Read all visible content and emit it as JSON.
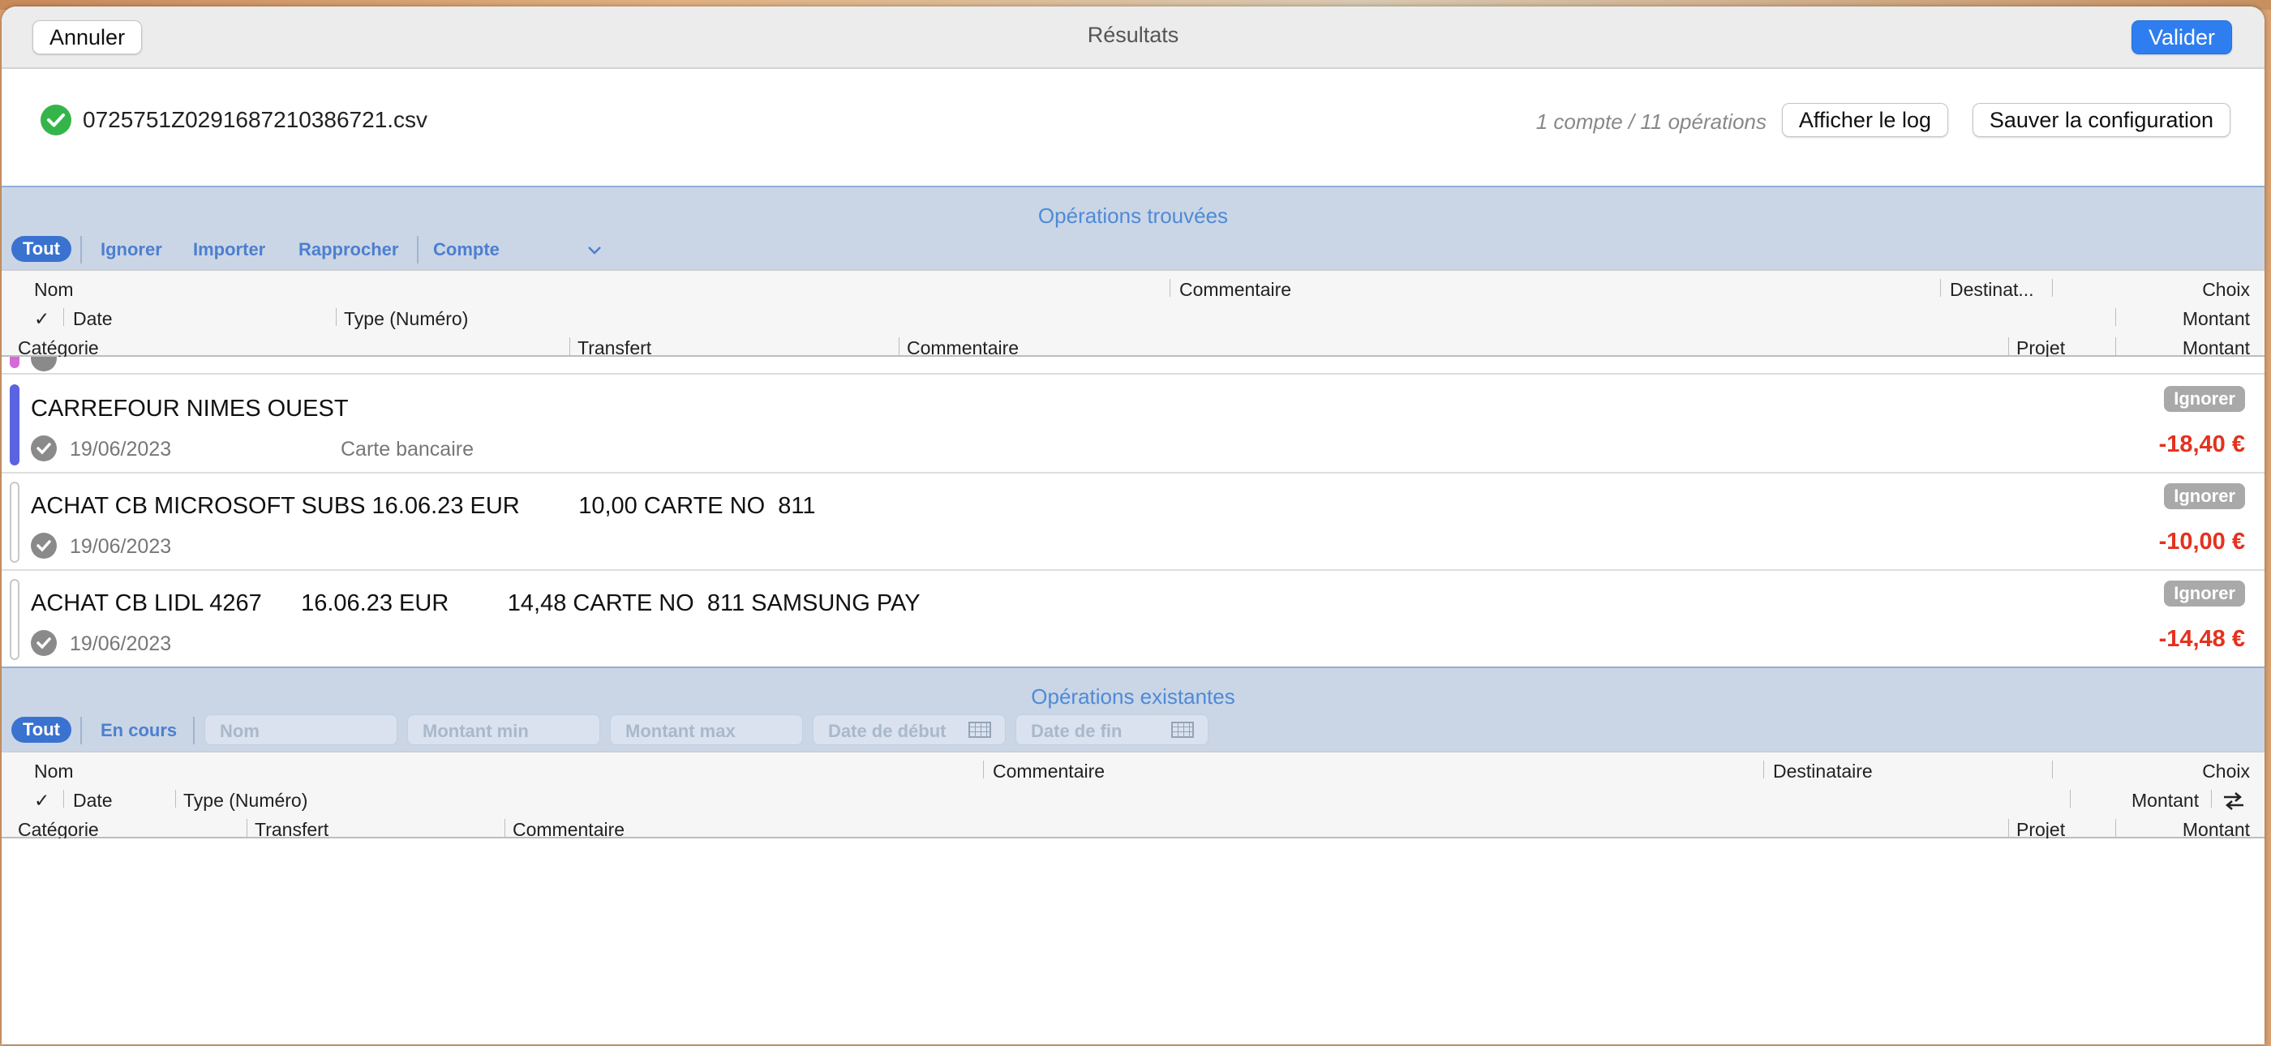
{
  "window": {
    "title": "Résultats",
    "cancel_label": "Annuler",
    "validate_label": "Valider",
    "accent": "#2f7ef0"
  },
  "file": {
    "name": "0725751Z0291687210386721.csv",
    "status_icon": "check-circle-icon",
    "summary": "1 compte / 11 opérations",
    "show_log_label": "Afficher le log",
    "save_config_label": "Sauver la configuration"
  },
  "found": {
    "section_title": "Opérations trouvées",
    "filters": {
      "all": "Tout",
      "ignore": "Ignorer",
      "import": "Importer",
      "reconcile": "Rapprocher",
      "account": "Compte"
    },
    "columns": {
      "name": "Nom",
      "comment": "Commentaire",
      "recipient": "Destinat...",
      "choice": "Choix",
      "check": "✓",
      "date": "Date",
      "type": "Type (Numéro)",
      "amount": "Montant",
      "category": "Catégorie",
      "transfer": "Transfert",
      "comment2": "Commentaire",
      "project": "Projet",
      "amount2": "Montant"
    },
    "rows": [
      {
        "name": "CARREFOUR NIMES OUEST",
        "date": "19/06/2023",
        "type": "Carte bancaire",
        "choice": "Ignorer",
        "amount": "-18,40 €",
        "marker_color": "#5b63e0"
      },
      {
        "name": "ACHAT CB MICROSOFT SUBS 16.06.23 EUR         10,00 CARTE NO  811",
        "date": "19/06/2023",
        "type": "",
        "choice": "Ignorer",
        "amount": "-10,00 €",
        "marker_color": "#ffffff"
      },
      {
        "name": "ACHAT CB LIDL 4267      16.06.23 EUR         14,48 CARTE NO  811 SAMSUNG PAY",
        "date": "19/06/2023",
        "type": "",
        "choice": "Ignorer",
        "amount": "-14,48 €",
        "marker_color": "#ffffff"
      }
    ]
  },
  "existing": {
    "section_title": "Opérations existantes",
    "filters": {
      "all": "Tout",
      "pending": "En cours"
    },
    "search": {
      "name_placeholder": "Nom",
      "min_placeholder": "Montant min",
      "max_placeholder": "Montant max",
      "start_placeholder": "Date de début",
      "end_placeholder": "Date de fin"
    },
    "columns": {
      "name": "Nom",
      "comment": "Commentaire",
      "recipient": "Destinataire",
      "choice": "Choix",
      "check": "✓",
      "date": "Date",
      "type": "Type (Numéro)",
      "amount": "Montant",
      "category": "Catégorie",
      "transfer": "Transfert",
      "comment2": "Commentaire",
      "project": "Projet",
      "amount2": "Montant"
    }
  }
}
